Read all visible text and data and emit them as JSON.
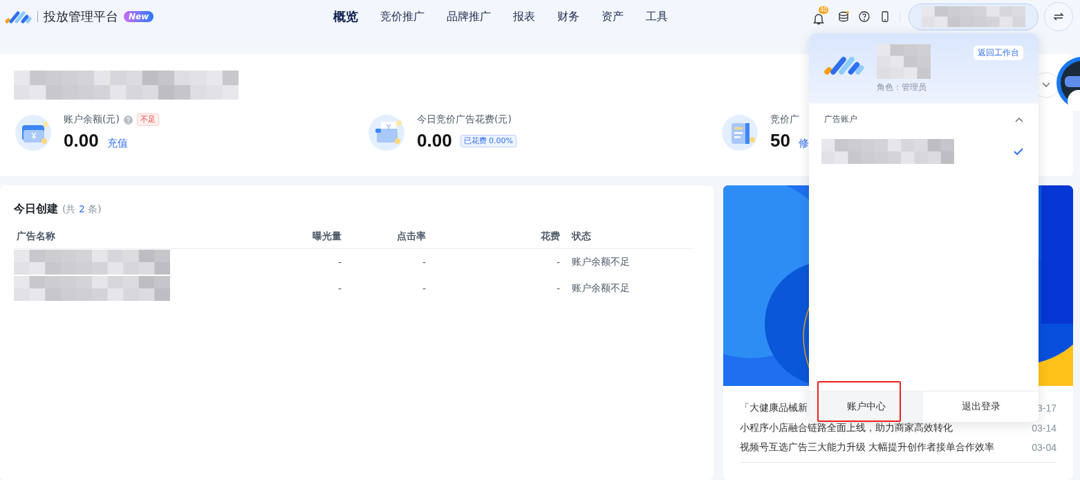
{
  "header": {
    "title": "投放管理平台",
    "badge": "New",
    "nav": [
      {
        "label": "概览",
        "selected": true
      },
      {
        "label": "竞价推广",
        "selected": false
      },
      {
        "label": "品牌推广",
        "selected": false
      },
      {
        "label": "报表",
        "selected": false
      },
      {
        "label": "财务",
        "selected": false
      },
      {
        "label": "资产",
        "selected": false
      },
      {
        "label": "工具",
        "selected": false
      }
    ],
    "notification_count": "40"
  },
  "stats": [
    {
      "kind": "balance",
      "label": "账户余额(元)",
      "tag": "不足",
      "value": "0.00",
      "link": "充值"
    },
    {
      "kind": "spend",
      "label": "今日竞价广告花费(元)",
      "tag": "已花费 0.00%",
      "value": "0.00"
    },
    {
      "kind": "ads",
      "label": "竞价广",
      "value": "50",
      "link": "修"
    }
  ],
  "today": {
    "title": "今日创建",
    "count_prefix": "(共",
    "count": "2",
    "count_suffix": "条)",
    "columns": [
      "广告名称",
      "曝光量",
      "点击率",
      "花费",
      "状态"
    ],
    "rows": [
      {
        "impressions": "-",
        "ctr": "-",
        "cost": "-",
        "status": "账户余额不足"
      },
      {
        "impressions": "-",
        "ctr": "-",
        "cost": "-",
        "status": "账户余额不足"
      }
    ]
  },
  "news": [
    {
      "title": "「大健康品械新",
      "date": "3-17"
    },
    {
      "title": "小程序小店融合链路全面上线，助力商家高效转化",
      "date": "03-14"
    },
    {
      "title": "视频号互选广告三大能力升级 大幅提升创作者接单合作效率",
      "date": "03-04"
    }
  ],
  "account_menu": {
    "back": "返回工作台",
    "role": "角色：管理员",
    "section": "广告账户",
    "expanded": true,
    "accounts": [
      {
        "selected": true
      }
    ],
    "footer": [
      {
        "label": "账户中心",
        "highlighted": true
      },
      {
        "label": "退出登录",
        "highlighted": false
      }
    ]
  }
}
